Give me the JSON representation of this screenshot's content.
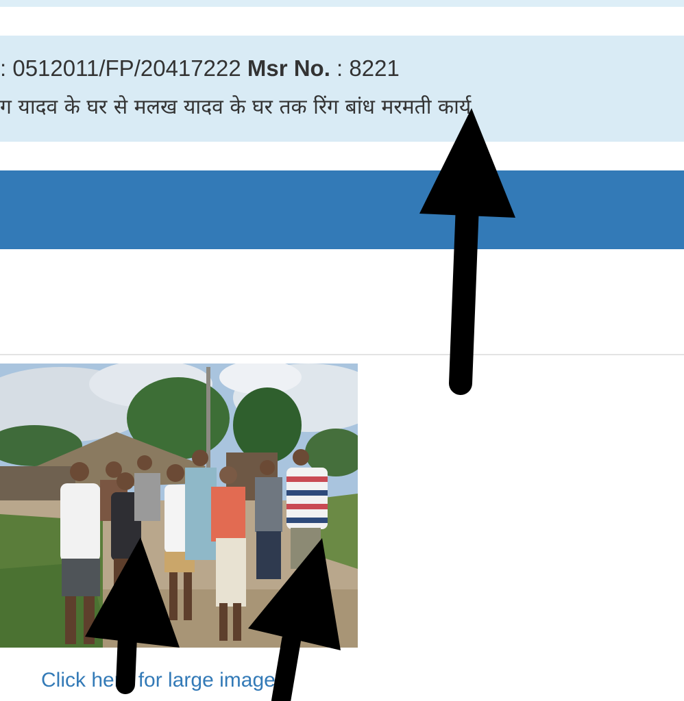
{
  "header_strip": {},
  "info": {
    "work_code_prefix": ": 0512011/FP/20417222 ",
    "msr_label": "Msr No.",
    "msr_value": " : 8221",
    "work_name": "ग यादव के घर से मलख यादव के घर तक रिंग बांध मरमती कार्य"
  },
  "photo": {
    "link_text": "Click here for large image"
  },
  "colors": {
    "info_bg": "#d9ebf5",
    "bar_blue": "#337ab7",
    "link": "#337ab7"
  },
  "icons": [
    "arrow-up-icon",
    "arrow-up-icon",
    "arrow-up-icon"
  ]
}
